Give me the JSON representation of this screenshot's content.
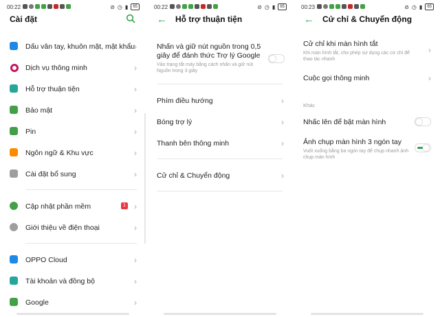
{
  "screen1": {
    "status_time": "00:22",
    "battery": "65",
    "title": "Cài đặt",
    "icon": "search-icon",
    "items": [
      {
        "label": "Dấu vân tay, khuôn mặt, mật khẩu",
        "icon": "fingerprint-icon",
        "color": "#1e88e5"
      },
      {
        "label": "Dịch vụ thông minh",
        "icon": "smart-service-icon",
        "color": "#c2185b"
      },
      {
        "label": "Hỗ trợ thuận tiện",
        "icon": "hand-icon",
        "color": "#26a69a"
      },
      {
        "label": "Bảo mật",
        "icon": "shield-icon",
        "color": "#43a047"
      },
      {
        "label": "Pin",
        "icon": "battery-icon",
        "color": "#43a047"
      },
      {
        "label": "Ngôn ngữ & Khu vực",
        "icon": "language-icon",
        "color": "#fb8c00"
      },
      {
        "label": "Cài đặt bổ sung",
        "icon": "gear-icon",
        "color": "#9e9e9e"
      },
      {
        "label": "Cập nhật phần mềm",
        "icon": "update-icon",
        "color": "#43a047",
        "badge": "1"
      },
      {
        "label": "Giới thiệu về điện thoại",
        "icon": "info-icon",
        "color": "#9e9e9e"
      },
      {
        "label": "OPPO Cloud",
        "icon": "cloud-icon",
        "color": "#1e88e5"
      },
      {
        "label": "Tài khoản và đồng bộ",
        "icon": "account-icon",
        "color": "#26a69a"
      },
      {
        "label": "Google",
        "icon": "google-icon",
        "color": "#43a047"
      }
    ]
  },
  "screen2": {
    "status_time": "00:22",
    "battery": "65",
    "title": "Hỗ trợ thuận tiện",
    "power_title": "Nhấn và giữ nút nguồn trong 0,5 giây để đánh thức Trợ lý Google",
    "power_sub": "Vào trạng tắt máy bằng cách nhấn và giữ nút Nguồn trong 3 giây",
    "items": [
      "Phím điều hướng",
      "Bóng trợ lý",
      "Thanh bên thông minh",
      "Cử chỉ & Chuyển động"
    ]
  },
  "screen3": {
    "status_time": "00:23",
    "battery": "65",
    "title": "Cử chỉ & Chuyển động",
    "screen_off_title": "Cử chỉ khi màn hình tắt",
    "screen_off_sub": "Khi màn hình tắt, cho phép sử dụng các cử chỉ để thao tác nhanh",
    "smart_call": "Cuộc gọi thông minh",
    "section_other": "Khác",
    "raise_to_wake": "Nhấc lên để bật màn hình",
    "three_finger_title": "Ảnh chụp màn hình 3 ngón tay",
    "three_finger_sub": "Vuốt xuống bằng ba ngón tay để chụp nhanh ảnh chụp màn hình"
  },
  "colors": {
    "accent": "#2fa44f",
    "badge": "#e63946"
  }
}
